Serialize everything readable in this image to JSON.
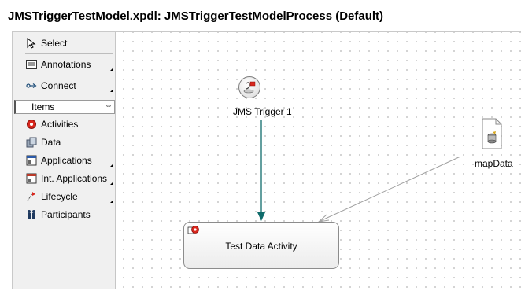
{
  "header": {
    "title": "JMSTriggerTestModel.xpdl: JMSTriggerTestModelProcess (Default)"
  },
  "palette": {
    "select": "Select",
    "annotations": "Annotations",
    "connect": "Connect",
    "drawer": "Items",
    "items": [
      "Activities",
      "Data",
      "Applications",
      "Int. Applications",
      "Lifecycle",
      "Participants"
    ]
  },
  "canvas": {
    "trigger_label": "JMS Trigger 1",
    "activity_label": "Test Data Activity",
    "data_label": "mapData"
  },
  "colors": {
    "connection_accent": "#0f6b6b",
    "association": "#a0a0a0"
  }
}
